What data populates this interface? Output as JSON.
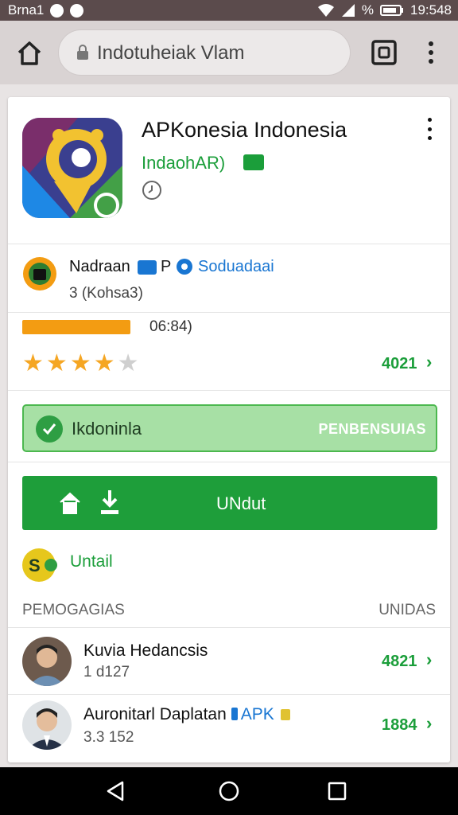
{
  "status_bar": {
    "carrier": "Brna1",
    "battery_percent": "%",
    "time": "19:548"
  },
  "browser": {
    "url": "Indotuheiak Vlam"
  },
  "app": {
    "title": "APKonesia Indonesia",
    "developer": "IndaohAR)"
  },
  "publisher": {
    "name": "Nadraan",
    "badge_letter": "P",
    "link": "Soduadaai",
    "subtitle": "3 (Kohsa3)"
  },
  "rating": {
    "meta": "06:84)",
    "stars": 3.5,
    "count": "4021"
  },
  "banner": {
    "label": "Ikdoninla",
    "action": "PENBENSUIAS"
  },
  "install": {
    "label": "UNdut"
  },
  "untail": {
    "icon_text": "S",
    "label": "Untail"
  },
  "section": {
    "left": "PEMOGAGIAS",
    "right": "UNIDAS"
  },
  "reviews": [
    {
      "name": "Kuvia Hedancsis",
      "sub": "1 d127",
      "count": "4821"
    },
    {
      "name": "Auronitarl Daplatan",
      "apk": "APK",
      "sub": "3.3 152",
      "count": "1884"
    }
  ],
  "colors": {
    "accent_green": "#1e9e3a",
    "banner_bg": "#a7e0a5",
    "link_blue": "#1976d2",
    "star": "#f5a623"
  }
}
